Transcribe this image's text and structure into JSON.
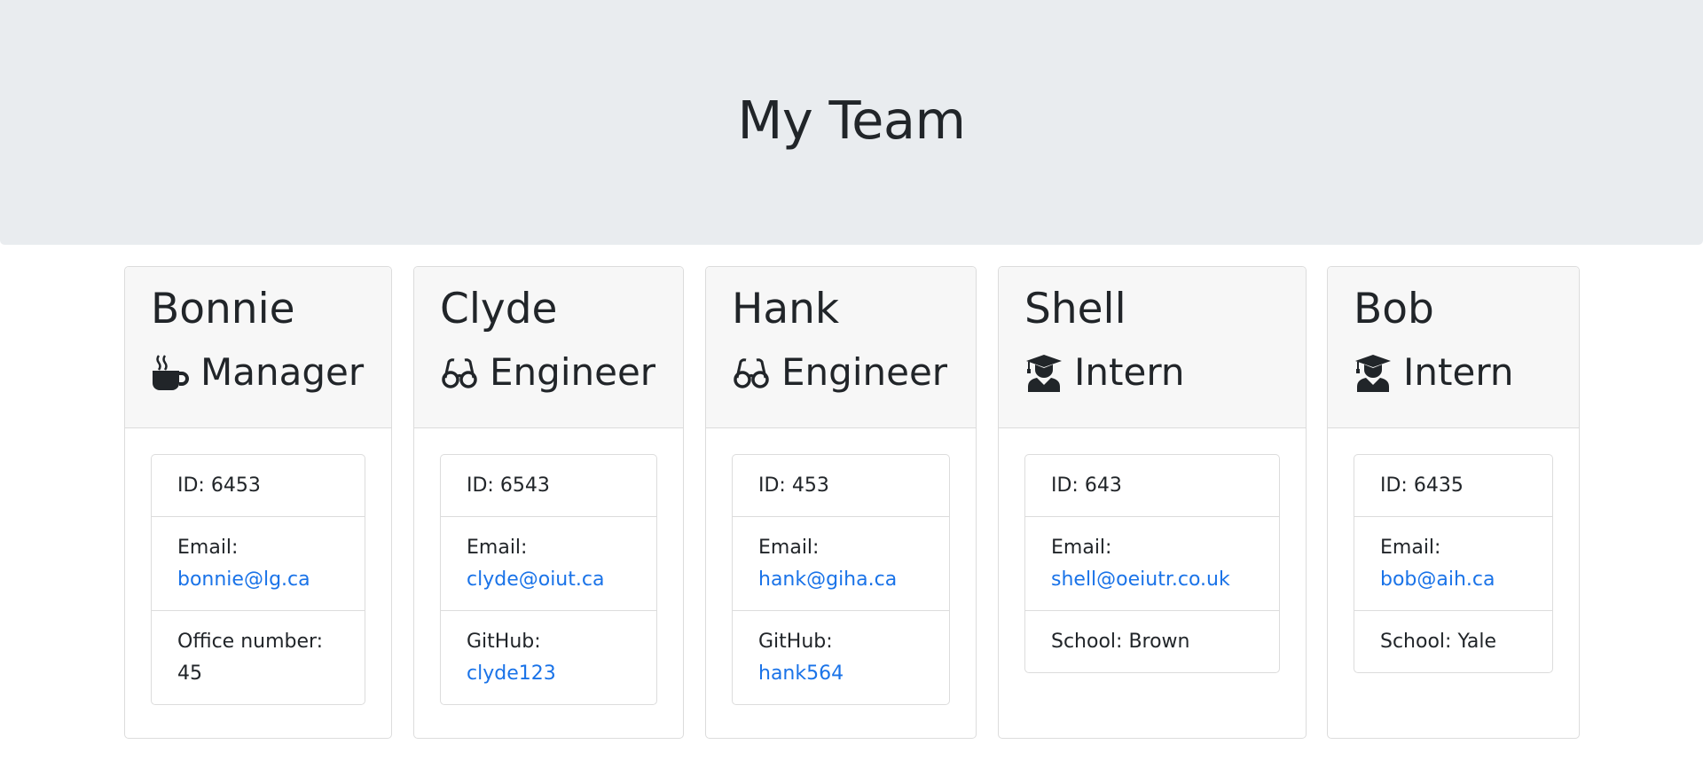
{
  "header": {
    "title": "My Team"
  },
  "team": [
    {
      "name": "Bonnie",
      "role": "Manager",
      "icon": "coffee-mug-icon",
      "id_text": "ID: 6453",
      "email_label": "Email:",
      "email": "bonnie@lg.ca",
      "extra_label": "Office number:",
      "extra_value": "45"
    },
    {
      "name": "Clyde",
      "role": "Engineer",
      "icon": "glasses-icon",
      "id_text": "ID: 6543",
      "email_label": "Email:",
      "email": "clyde@oiut.ca",
      "extra_label": "GitHub:",
      "extra_value": "clyde123"
    },
    {
      "name": "Hank",
      "role": "Engineer",
      "icon": "glasses-icon",
      "id_text": "ID: 453",
      "email_label": "Email:",
      "email": "hank@giha.ca",
      "extra_label": "GitHub:",
      "extra_value": "hank564"
    },
    {
      "name": "Shell",
      "role": "Intern",
      "icon": "graduate-icon",
      "id_text": "ID: 643",
      "email_label": "Email:",
      "email": "shell@oeiutr.co.uk",
      "extra_label": "School: Brown",
      "extra_value": ""
    },
    {
      "name": "Bob",
      "role": "Intern",
      "icon": "graduate-icon",
      "id_text": "ID: 6435",
      "email_label": "Email:",
      "email": "bob@aih.ca",
      "extra_label": "School: Yale",
      "extra_value": ""
    }
  ],
  "colors": {
    "jumbotron_bg": "#e9ecef",
    "card_header_bg": "#f7f7f7",
    "link": "#1a73e8",
    "text": "#212529"
  }
}
